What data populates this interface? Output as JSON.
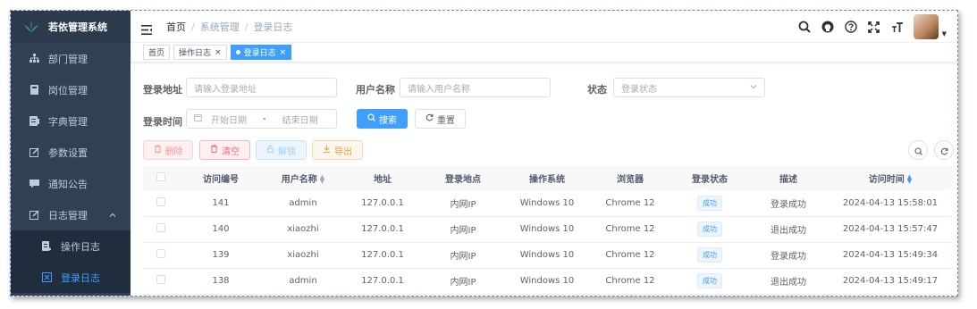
{
  "app": {
    "title": "若依管理系统"
  },
  "sidebar": {
    "items": [
      {
        "label": "部门管理",
        "icon": "tree-icon"
      },
      {
        "label": "岗位管理",
        "icon": "post-icon"
      },
      {
        "label": "字典管理",
        "icon": "dict-icon"
      },
      {
        "label": "参数设置",
        "icon": "edit-icon"
      },
      {
        "label": "通知公告",
        "icon": "message-icon"
      },
      {
        "label": "日志管理",
        "icon": "log-icon"
      }
    ],
    "subitems": [
      {
        "label": "操作日志",
        "icon": "form-icon"
      },
      {
        "label": "登录日志",
        "icon": "logininfor-icon"
      }
    ]
  },
  "navbar": {
    "breadcrumb": [
      "首页",
      "系统管理",
      "登录日志"
    ]
  },
  "tags": [
    {
      "label": "首页"
    },
    {
      "label": "操作日志"
    },
    {
      "label": "登录日志"
    }
  ],
  "form": {
    "ipaddr_label": "登录地址",
    "ipaddr_placeholder": "请输入登录地址",
    "username_label": "用户名称",
    "username_placeholder": "请输入用户名称",
    "status_label": "状态",
    "status_placeholder": "登录状态",
    "time_label": "登录时间",
    "start_placeholder": "开始日期",
    "range_sep": "-",
    "end_placeholder": "结束日期",
    "search_label": "搜索",
    "reset_label": "重置"
  },
  "toolbar": {
    "delete_label": "删除",
    "clean_label": "清空",
    "unlock_label": "解锁",
    "export_label": "导出"
  },
  "table": {
    "headers": [
      "访问编号",
      "用户名称",
      "地址",
      "登录地点",
      "操作系统",
      "浏览器",
      "登录状态",
      "描述",
      "访问时间"
    ],
    "rows": [
      [
        "141",
        "admin",
        "127.0.0.1",
        "内网IP",
        "Windows 10",
        "Chrome 12",
        "成功",
        "登录成功",
        "2024-04-13 15:58:01"
      ],
      [
        "140",
        "xiaozhi",
        "127.0.0.1",
        "内网IP",
        "Windows 10",
        "Chrome 12",
        "成功",
        "退出成功",
        "2024-04-13 15:57:47"
      ],
      [
        "139",
        "xiaozhi",
        "127.0.0.1",
        "内网IP",
        "Windows 10",
        "Chrome 12",
        "成功",
        "登录成功",
        "2024-04-13 15:49:34"
      ],
      [
        "138",
        "admin",
        "127.0.0.1",
        "内网IP",
        "Windows 10",
        "Chrome 12",
        "成功",
        "退出成功",
        "2024-04-13 15:49:17"
      ]
    ]
  },
  "colors": {
    "sidebar_bg": "#304156",
    "primary": "#409eff",
    "danger": "#f56c6c",
    "warning": "#e6a23c"
  }
}
